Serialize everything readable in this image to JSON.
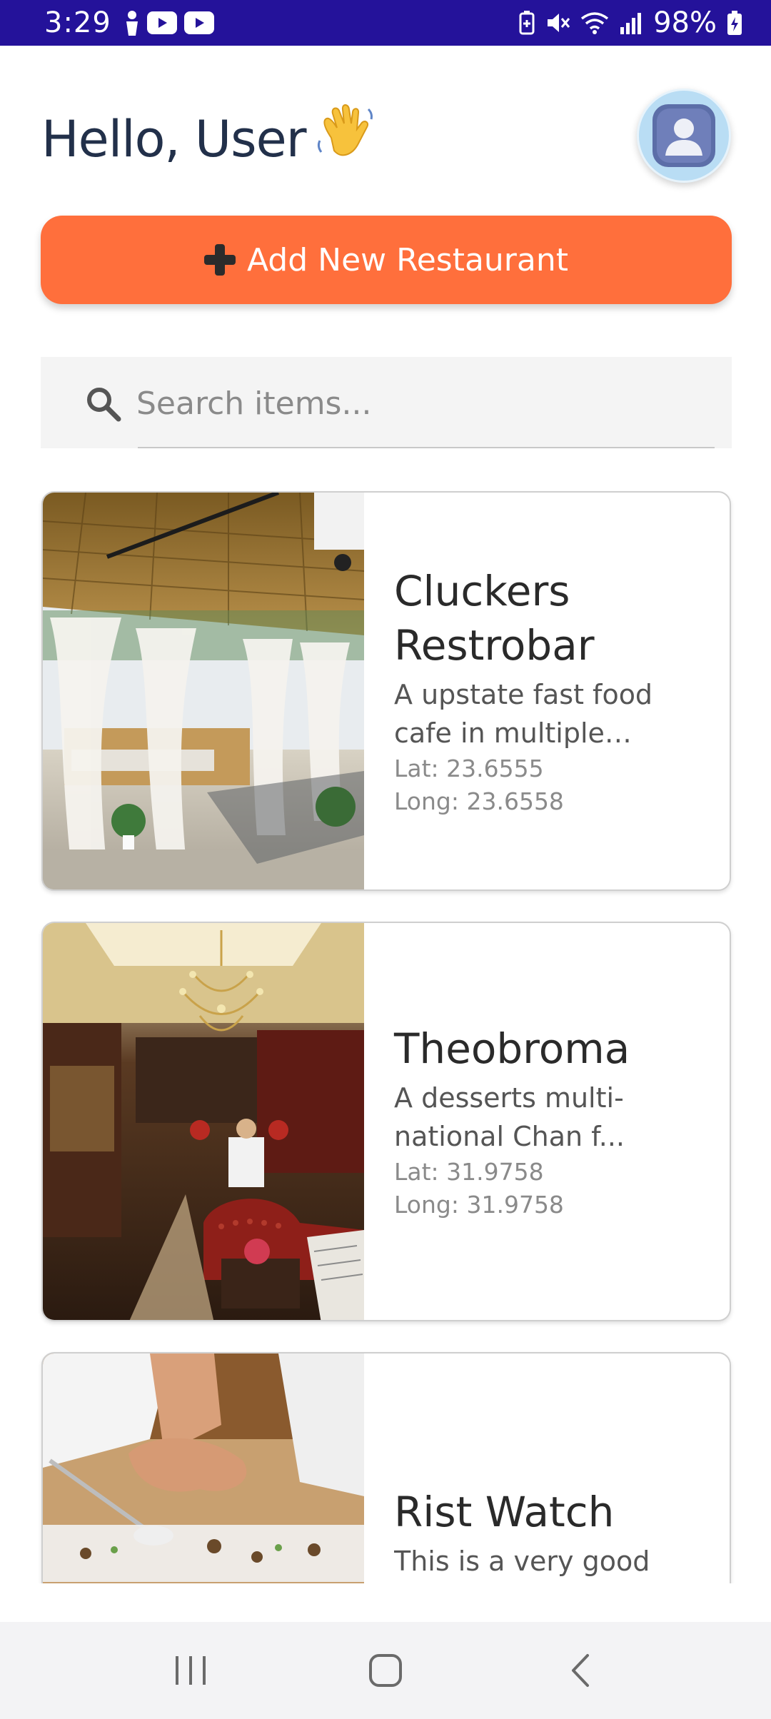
{
  "status_bar": {
    "time": "3:29",
    "battery_percent": "98%",
    "left_icons": [
      "person-icon",
      "youtube-icon",
      "youtube-icon"
    ],
    "right_icons": [
      "battery-saver-icon",
      "mute-icon",
      "wifi-icon",
      "signal-icon",
      "battery-charging-icon"
    ]
  },
  "header": {
    "greeting": "Hello, User",
    "greeting_emoji": "waving-hand-icon",
    "avatar_icon": "user-avatar-icon"
  },
  "add_button": {
    "icon": "plus-icon",
    "label": "Add New Restaurant"
  },
  "search": {
    "placeholder": "Search items...",
    "value": "",
    "icon": "search-icon"
  },
  "restaurants": [
    {
      "name": "Cluckers Restrobar",
      "description": "A upstate fast food cafe in multiple locations a...",
      "lat": "Lat: 23.6555",
      "long": "Long: 23.6558"
    },
    {
      "name": "Theobroma",
      "description": "A desserts multi-national Chan f...",
      "lat": "Lat: 31.9758",
      "long": "Long: 31.9758"
    },
    {
      "name": "Rist Watch",
      "description": "This is a very good watch having all the f...",
      "lat": "",
      "long": ""
    }
  ],
  "nav_bar": {
    "buttons": [
      "recent-apps-icon",
      "home-icon",
      "back-icon"
    ]
  },
  "colors": {
    "status_bar": "#24129a",
    "accent": "#ff6f3c",
    "heading": "#22304a",
    "avatar_bg": "#b9ddf4"
  }
}
